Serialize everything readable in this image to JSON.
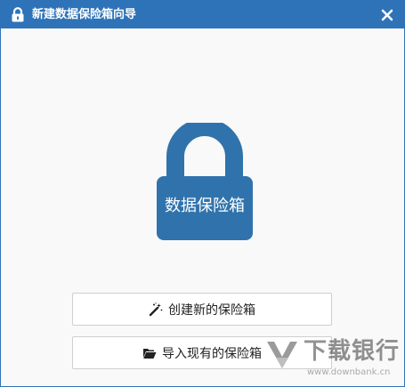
{
  "window": {
    "title": "新建数据保险箱向导",
    "close_icon": "close-icon"
  },
  "hero": {
    "icon": "padlock-icon",
    "label": "数据保险箱"
  },
  "actions": {
    "create_label": "创建新的保险箱",
    "create_icon": "magic-wand-icon",
    "import_label": "导入现有的保险箱",
    "import_icon": "folder-open-icon"
  },
  "watermark": {
    "text": "下载银行",
    "url_text": "www.downbank.cn"
  },
  "colors": {
    "accent": "#2e73b8",
    "padlock": "#3073ac",
    "background": "#f9f9f9"
  }
}
